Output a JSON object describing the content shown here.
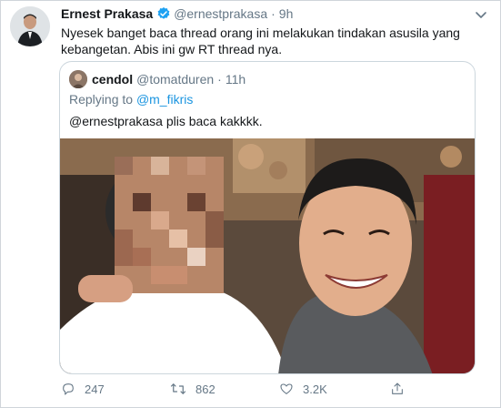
{
  "tweet": {
    "author_name": "Ernest Prakasa",
    "handle": "@ernestprakasa",
    "separator": "·",
    "time": "9h",
    "text": "Nyesek banget baca thread orang ini melakukan tindakan asusila yang kebangetan. Abis ini gw RT thread nya."
  },
  "quoted": {
    "author_name": "cendol",
    "handle": "@tomatduren",
    "separator": "·",
    "time": "11h",
    "replying_prefix": "Replying to",
    "replying_to": "@m_fikris",
    "text": "@ernestprakasa plis baca kakkkk."
  },
  "actions": {
    "replies": "247",
    "retweets": "862",
    "likes": "3.2K"
  },
  "icons": [
    "verified-badge-icon",
    "caret-down-icon",
    "reply-icon",
    "retweet-icon",
    "like-icon",
    "share-icon"
  ],
  "colors": {
    "verified": "#1da1f2",
    "link": "#1b95e0",
    "muted": "#657786",
    "text": "#14171a",
    "border": "#ccd6dd"
  }
}
